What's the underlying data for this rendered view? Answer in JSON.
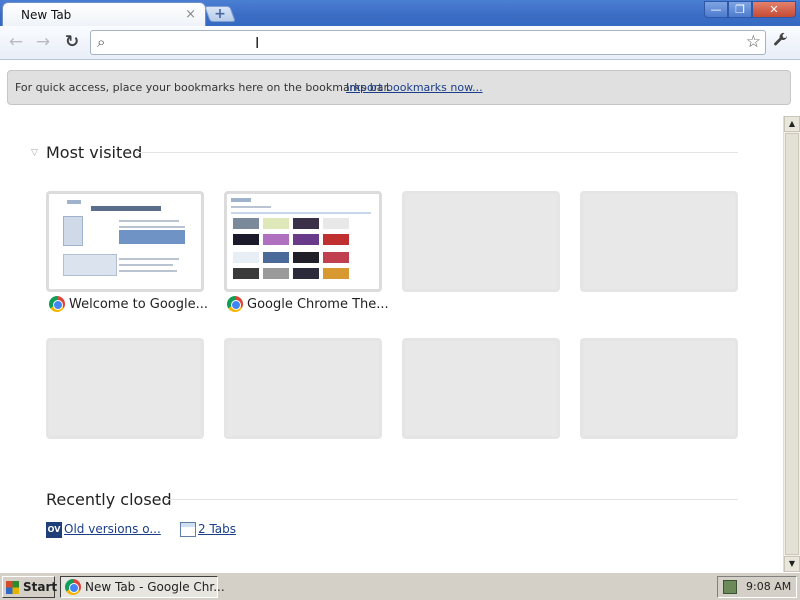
{
  "tab": {
    "title": "New Tab",
    "close_glyph": "×"
  },
  "window_controls": {
    "minimize": "—",
    "maximize": "❐",
    "close": "✕"
  },
  "toolbar": {
    "back_glyph": "←",
    "forward_glyph": "→",
    "reload_glyph": "↻",
    "omnibox_value": "",
    "omnibox_placeholder": "",
    "star_glyph": "☆",
    "wrench_glyph": "🔧",
    "new_tab_glyph": "+"
  },
  "bookmarks_bar": {
    "message": "For quick access, place your bookmarks here on the bookmarks bar.",
    "import_link": "Import bookmarks now..."
  },
  "most_visited": {
    "title": "Most visited",
    "items": [
      {
        "label": "Welcome to Google...",
        "filled": true
      },
      {
        "label": "Google Chrome The...",
        "filled": true
      },
      {
        "label": "",
        "filled": false
      },
      {
        "label": "",
        "filled": false
      },
      {
        "label": "",
        "filled": false
      },
      {
        "label": "",
        "filled": false
      },
      {
        "label": "",
        "filled": false
      },
      {
        "label": "",
        "filled": false
      }
    ]
  },
  "recently_closed": {
    "title": "Recently closed",
    "items": [
      {
        "label": "Old versions o...",
        "icon": "ov-icon",
        "icon_text": "OV"
      },
      {
        "label": "2 Tabs",
        "icon": "window-icon"
      }
    ]
  },
  "taskbar": {
    "start_label": "Start",
    "task_label": "New Tab - Google Chr...",
    "clock": "9:08 AM"
  },
  "colors": {
    "titlebar": "#3b6cc4",
    "link": "#1a3e8a",
    "taskbar": "#d4d0c8"
  }
}
